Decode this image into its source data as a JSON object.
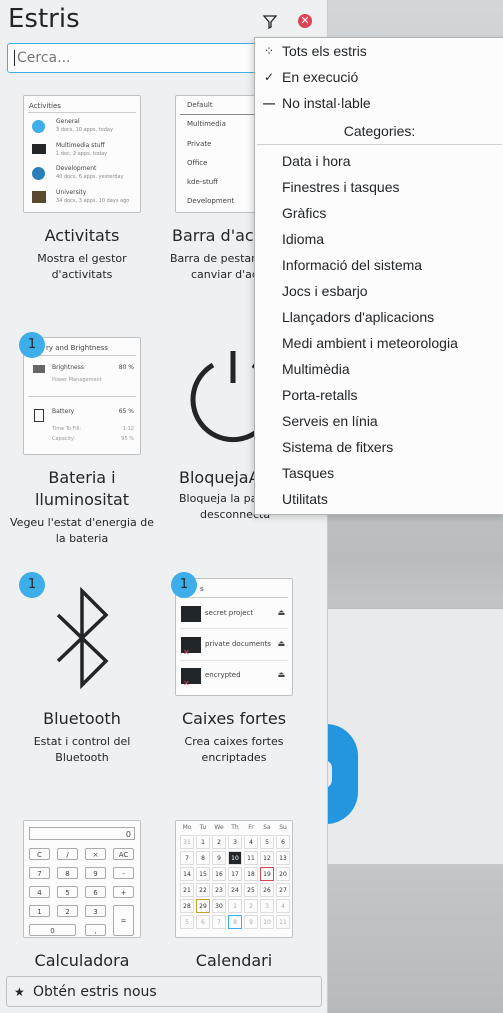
{
  "panel": {
    "title": "Estris",
    "search_placeholder": "Cerca...",
    "get_new_label": "Obtén estris nous"
  },
  "widgets": [
    {
      "name": "Activitats",
      "desc1": "Mostra el gestor",
      "desc2": "d'activitats",
      "badge": ""
    },
    {
      "name": "Barra d'act",
      "desc1": "Barra de pestany",
      "desc2": "canviar d'act",
      "badge": ""
    },
    {
      "name": "Bateria i",
      "name2": "lluminositat",
      "desc1": "Vegeu l'estat d'energia de",
      "desc2": "la bateria",
      "badge": "1"
    },
    {
      "name": "BloquejaA",
      "desc1": "Bloqueja la pan",
      "desc2": "desconnecta",
      "badge": ""
    },
    {
      "name": "Bluetooth",
      "desc1": "Estat i control del",
      "desc2": "Bluetooth",
      "badge": "1"
    },
    {
      "name": "Caixes fortes",
      "desc1": "Crea caixes fortes",
      "desc2": "encriptades",
      "badge": "1"
    },
    {
      "name": "Calculadora"
    },
    {
      "name": "Calendari"
    }
  ],
  "activities_thumb": {
    "header": "Activities",
    "items": [
      {
        "title": "General",
        "sub": "3 docs, 10 apps, today"
      },
      {
        "title": "Multimedia stuff",
        "sub": "1 doc, 2 apps, today"
      },
      {
        "title": "Development",
        "sub": "40 docs, 6 apps, yesterday"
      },
      {
        "title": "University",
        "sub": "34 docs, 3 apps, 10 days ago"
      }
    ]
  },
  "activitybar_thumb": {
    "items": [
      "Default",
      "Multimedia",
      "Private",
      "Office",
      "kde-stuff",
      "Development"
    ]
  },
  "battery_thumb": {
    "header": "ry and Brightness",
    "brightness_label": "Brightness",
    "brightness_value": "80 %",
    "power_mgmt": "Power Management",
    "battery_label": "Battery",
    "battery_value": "65 %",
    "ttf_label": "Time To Fill:",
    "ttf_value": "1:12",
    "cap_label": "Capacity:",
    "cap_value": "95 %"
  },
  "vaults_thumb": {
    "header": "s",
    "items": [
      "secret project",
      "private documents",
      "encrypted"
    ]
  },
  "calc_thumb": {
    "display": "0",
    "keys": [
      "C",
      "/",
      "×",
      "AC",
      "7",
      "8",
      "9",
      "-",
      "4",
      "5",
      "6",
      "+",
      "1",
      "2",
      "3",
      "=",
      "0",
      ","
    ]
  },
  "calendar_thumb": {
    "days": [
      "Mo",
      "Tu",
      "We",
      "Th",
      "Fr",
      "Sa",
      "Su"
    ],
    "rows": [
      [
        "31",
        "1",
        "2",
        "3",
        "4",
        "5",
        "6"
      ],
      [
        "7",
        "8",
        "9",
        "10",
        "11",
        "12",
        "13"
      ],
      [
        "14",
        "15",
        "16",
        "17",
        "18",
        "19",
        "20"
      ],
      [
        "21",
        "22",
        "23",
        "24",
        "25",
        "26",
        "27"
      ],
      [
        "28",
        "29",
        "30",
        "1",
        "2",
        "3",
        "4"
      ],
      [
        "5",
        "6",
        "7",
        "8",
        "9",
        "10",
        "11"
      ]
    ]
  },
  "menu": {
    "top_items": [
      {
        "label": "Tots els estris",
        "icon": "all-icon"
      },
      {
        "label": "En execució",
        "icon": "check-icon"
      },
      {
        "label": "No instal·lable",
        "icon": "dash-icon"
      }
    ],
    "section_title": "Categories:",
    "categories": [
      "Data i hora",
      "Finestres i tasques",
      "Gràfics",
      "Idioma",
      "Informació del sistema",
      "Jocs i esbarjo",
      "Llançadors d'aplicacions",
      "Medi ambient i meteorologia",
      "Multimèdia",
      "Porta-retalls",
      "Serveis en línia",
      "Sistema de fitxers",
      "Tasques",
      "Utilitats"
    ]
  },
  "colors": {
    "accent": "#3daee9",
    "close": "#da4453",
    "desktop_blue": "#2496e0"
  }
}
